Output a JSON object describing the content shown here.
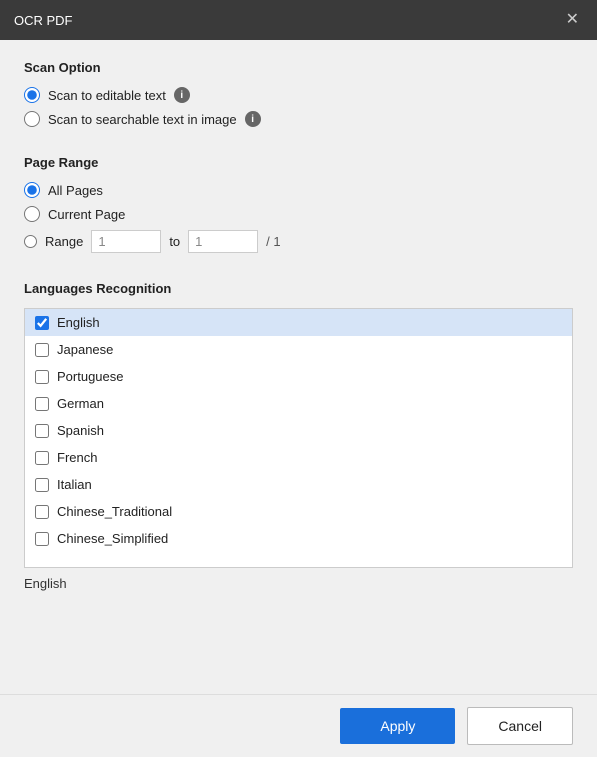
{
  "dialog": {
    "title": "OCR PDF",
    "close_label": "✕"
  },
  "scan_option": {
    "section_title": "Scan Option",
    "options": [
      {
        "id": "editable",
        "label": "Scan to editable text",
        "checked": true,
        "has_info": true
      },
      {
        "id": "searchable",
        "label": "Scan to searchable text in image",
        "checked": false,
        "has_info": true
      }
    ]
  },
  "page_range": {
    "section_title": "Page Range",
    "options": [
      {
        "id": "all",
        "label": "All Pages",
        "checked": true
      },
      {
        "id": "current",
        "label": "Current Page",
        "checked": false
      },
      {
        "id": "range",
        "label": "Range",
        "checked": false
      }
    ],
    "range_from": "1",
    "range_to": "1",
    "total": "/ 1",
    "to_label": "to"
  },
  "languages": {
    "section_title": "Languages Recognition",
    "items": [
      {
        "id": "english",
        "label": "English",
        "checked": true
      },
      {
        "id": "japanese",
        "label": "Japanese",
        "checked": false
      },
      {
        "id": "portuguese",
        "label": "Portuguese",
        "checked": false
      },
      {
        "id": "german",
        "label": "German",
        "checked": false
      },
      {
        "id": "spanish",
        "label": "Spanish",
        "checked": false
      },
      {
        "id": "french",
        "label": "French",
        "checked": false
      },
      {
        "id": "italian",
        "label": "Italian",
        "checked": false
      },
      {
        "id": "chinese_traditional",
        "label": "Chinese_Traditional",
        "checked": false
      },
      {
        "id": "chinese_simplified",
        "label": "Chinese_Simplified",
        "checked": false
      }
    ],
    "selected_text": "English"
  },
  "footer": {
    "apply_label": "Apply",
    "cancel_label": "Cancel"
  }
}
